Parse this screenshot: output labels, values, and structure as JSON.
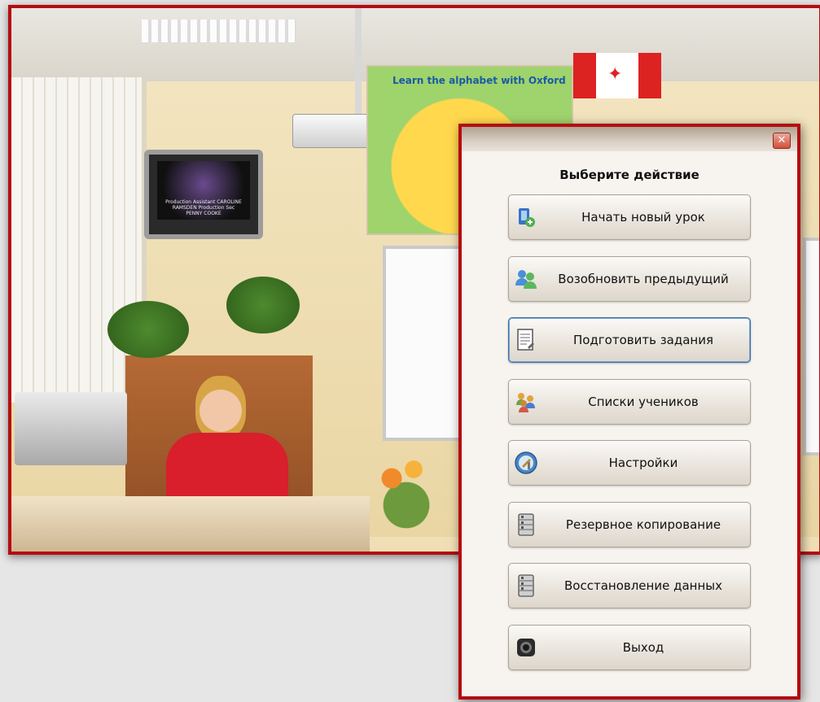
{
  "dialog": {
    "close_glyph": "✕",
    "heading": "Выберите действие",
    "actions": [
      {
        "label": "Начать новый урок",
        "icon": "new-lesson-icon"
      },
      {
        "label": "Возобновить предыдущий",
        "icon": "users-resume-icon"
      },
      {
        "label": "Подготовить задания",
        "icon": "document-edit-icon"
      },
      {
        "label": "Списки учеников",
        "icon": "student-list-icon"
      },
      {
        "label": "Настройки",
        "icon": "settings-icon"
      },
      {
        "label": "Резервное копирование",
        "icon": "database-backup-icon"
      },
      {
        "label": "Восстановление данных",
        "icon": "database-restore-icon"
      },
      {
        "label": "Выход",
        "icon": "exit-icon"
      }
    ],
    "focused_index": 2
  },
  "background_photo": {
    "poster_title": "Learn the alphabet with Oxford",
    "tv_caption": "Production Assistant CAROLINE RAMSDEN   Production Sec PENNY COOKE"
  },
  "colors": {
    "frame_red": "#b50d10",
    "focus_blue": "#3a6ea5"
  }
}
